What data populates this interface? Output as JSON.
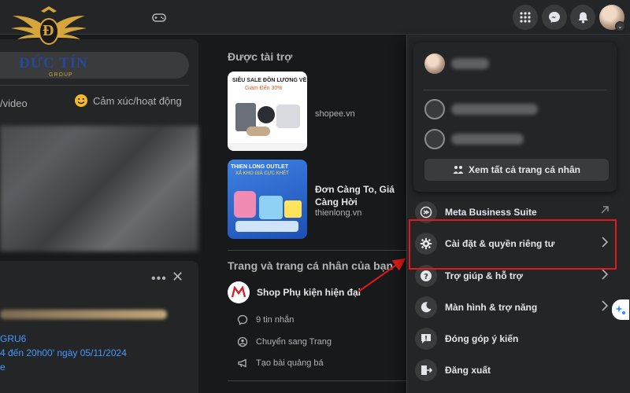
{
  "logo": {
    "brand": "ĐỨC TÍN",
    "group": "GROUP",
    "monogram": "Đ"
  },
  "topbar": {
    "icons": [
      "gamepad-icon",
      "grid-menu-icon",
      "messenger-icon",
      "bell-icon",
      "avatar-icon"
    ]
  },
  "feed": {
    "composer_video_label": "/video",
    "composer_feeling_label": "Cảm xúc/hoạt động",
    "post_link": "GRU6",
    "post_time": "4 đến 20h00' ngày 05/11/2024",
    "post_more": "e"
  },
  "sponsored": {
    "title": "Được tài trợ",
    "ads": [
      {
        "title": "",
        "domain": "shopee.vn",
        "banner_title": "SIÊU SALE ĐỒN LƯƠNG VỀ",
        "banner_sub": "Giảm Đến 30%"
      },
      {
        "title": "Đơn Càng To, Giá Càng Hời",
        "domain": "thienlong.vn",
        "banner_title": "THIEN LONG OUTLET",
        "banner_sub": "XẢ KHO GIÁ CỰC KHÉT"
      }
    ]
  },
  "pages": {
    "title": "Trang và trang cá nhân của bạn",
    "page_name": "Shop Phụ kiện hiện đại",
    "actions": [
      {
        "label": "9 tin nhắn",
        "icon": "message-icon"
      },
      {
        "label": "Chuyển sang Trang",
        "icon": "switch-profile-icon"
      },
      {
        "label": "Tạo bài quảng bá",
        "icon": "megaphone-icon"
      }
    ]
  },
  "dropdown": {
    "see_all_profiles": "Xem tất cả trang cá nhân",
    "menu": [
      {
        "label": "Meta Business Suite",
        "icon": "meta-business-icon"
      },
      {
        "label": "Cài đặt & quyền riêng tư",
        "icon": "gear-icon"
      },
      {
        "label": "Trợ giúp & hỗ trợ",
        "icon": "help-icon"
      },
      {
        "label": "Màn hình & trợ năng",
        "icon": "moon-icon"
      },
      {
        "label": "Đóng góp ý kiến",
        "icon": "feedback-icon"
      },
      {
        "label": "Đăng xuất",
        "icon": "logout-icon"
      }
    ]
  },
  "colors": {
    "background": "#18191a",
    "surface": "#242526",
    "highlight": "#e0191b",
    "link": "#4599ff"
  }
}
